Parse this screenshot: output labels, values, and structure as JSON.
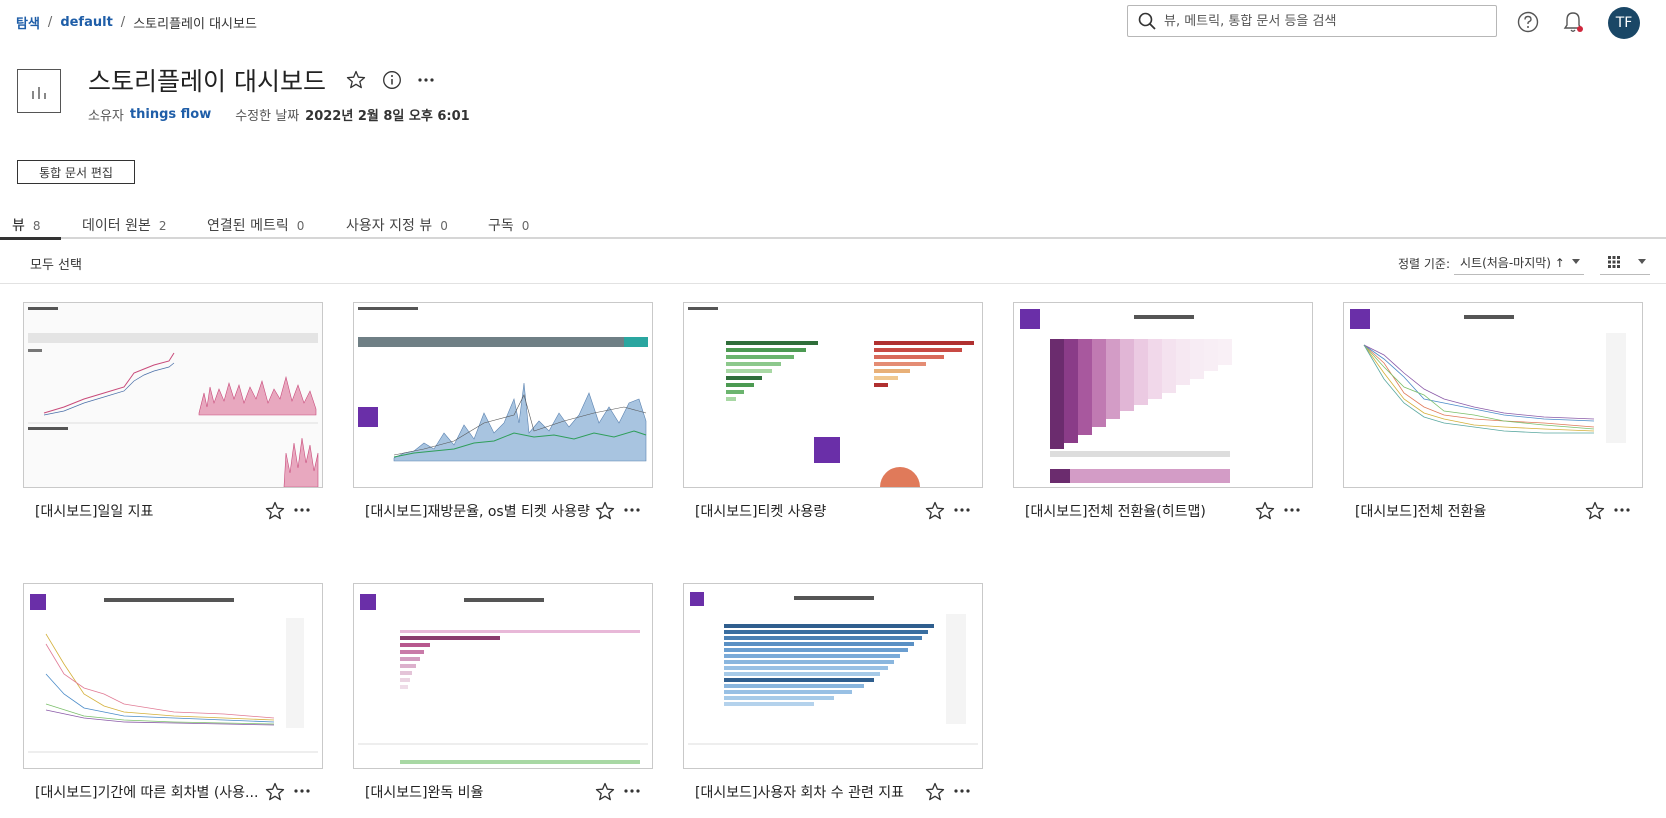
{
  "breadcrumb": {
    "explore": "탐색",
    "project": "default",
    "current": "스토리플레이 대시보드"
  },
  "search": {
    "placeholder": "뷰, 메트릭, 통합 문서 등을 검색"
  },
  "user": {
    "initials": "TF"
  },
  "workbook": {
    "title": "스토리플레이 대시보드",
    "owner_label": "소유자",
    "owner": "things flow",
    "modified_label": "수정한 날짜",
    "modified": "2022년 2월 8일 오후 6:01",
    "edit_button": "통합 문서 편집"
  },
  "tabs": [
    {
      "label": "뷰",
      "count": "8"
    },
    {
      "label": "데이터 원본",
      "count": "2"
    },
    {
      "label": "연결된 메트릭",
      "count": "0"
    },
    {
      "label": "사용자 지정 뷰",
      "count": "0"
    },
    {
      "label": "구독",
      "count": "0"
    }
  ],
  "toolbar": {
    "select_all": "모두 선택",
    "sort_label": "정렬 기준:",
    "sort_value": "시트(처음-마지막) ↑"
  },
  "views": [
    {
      "name": "[대시보드]일일 지표"
    },
    {
      "name": "[대시보드]재방문율, os별 티켓 사용량"
    },
    {
      "name": "[대시보드]티켓 사용량"
    },
    {
      "name": "[대시보드]전체 전환율(히트맵)"
    },
    {
      "name": "[대시보드]전체 전환율"
    },
    {
      "name": "[대시보드]기간에 따른 회차별 (사용..."
    },
    {
      "name": "[대시보드]완독 비율"
    },
    {
      "name": "[대시보드]사용자 회차 수 관련 지표"
    }
  ],
  "colors": {
    "link": "#1f5ea8",
    "avatar": "#1a4766",
    "notification_dot": "#d0273c",
    "storyplay_brand": "#6a2fa8"
  }
}
